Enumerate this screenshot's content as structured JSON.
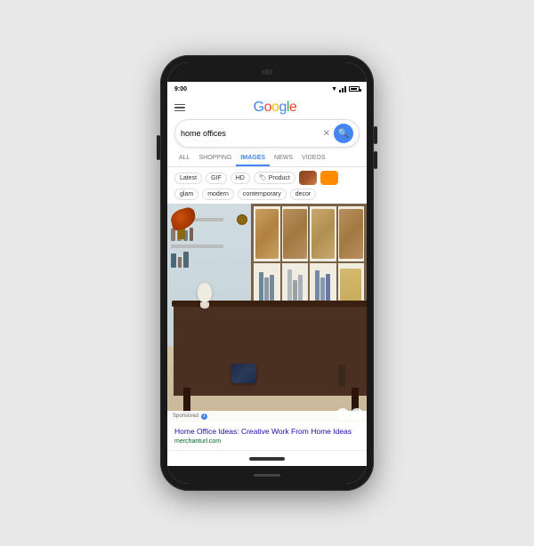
{
  "phone": {
    "status_bar": {
      "time": "9:00"
    },
    "header": {
      "google_logo": {
        "g": "G",
        "o1": "o",
        "o2": "o",
        "g2": "g",
        "l": "l",
        "e": "e"
      }
    },
    "search": {
      "query": "home offices",
      "clear_label": "✕",
      "search_icon": "🔍"
    },
    "tabs": [
      {
        "label": "ALL",
        "active": false
      },
      {
        "label": "SHOPPING",
        "active": false
      },
      {
        "label": "IMAGES",
        "active": true
      },
      {
        "label": "NEWS",
        "active": false
      },
      {
        "label": "VIDEOS",
        "active": false
      }
    ],
    "filters_row1": [
      {
        "label": "Latest",
        "type": "text"
      },
      {
        "label": "GIF",
        "type": "text"
      },
      {
        "label": "HD",
        "type": "text"
      },
      {
        "label": "🏷 Product",
        "type": "text"
      },
      {
        "label": "",
        "type": "swatch-brown"
      },
      {
        "label": "",
        "type": "swatch-orange"
      }
    ],
    "filters_row2": [
      {
        "label": "glam"
      },
      {
        "label": "modern"
      },
      {
        "label": "contemporary"
      },
      {
        "label": "decor"
      }
    ],
    "result": {
      "sponsored_label": "Sponsored",
      "title": "Home Office Ideas: Creative Work From Home Ideas",
      "url": "merchanturl.com"
    }
  }
}
